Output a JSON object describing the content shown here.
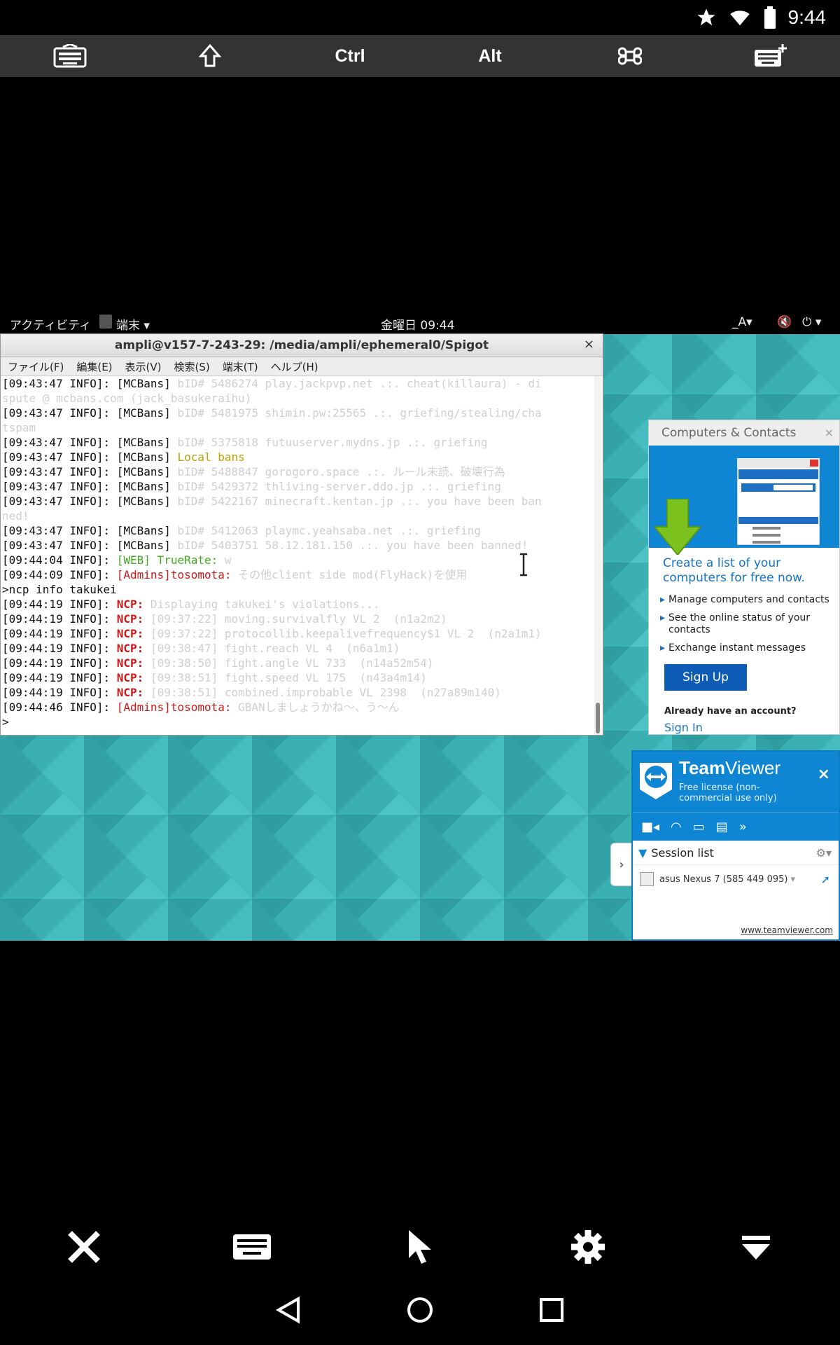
{
  "status_bar": {
    "time": "9:44",
    "icons": [
      "star-icon",
      "wifi-icon",
      "battery-icon"
    ]
  },
  "key_toolbar": {
    "keys": [
      {
        "icon": "keyboard-hide-icon",
        "label": ""
      },
      {
        "icon": "shift-icon",
        "label": ""
      },
      {
        "icon": "",
        "label": "Ctrl"
      },
      {
        "icon": "",
        "label": "Alt"
      },
      {
        "icon": "command-icon",
        "label": ""
      },
      {
        "icon": "keyboard-add-icon",
        "label": ""
      }
    ]
  },
  "gnome_bar": {
    "activities": "アクティビティ",
    "app_menu": "端末",
    "clock": "金曜日 09:44",
    "input_method": "_A",
    "right_icons": [
      "volume-muted-icon",
      "power-icon"
    ]
  },
  "terminal": {
    "title": "ampli@v157-7-243-29: /media/ampli/ephemeral0/Spigot",
    "close": "×",
    "menu": [
      "ファイル(F)",
      "編集(E)",
      "表示(V)",
      "検索(S)",
      "端末(T)",
      "ヘルプ(H)"
    ],
    "lines": [
      {
        "prefix": "[09:43:47 INFO]: [MCBans] ",
        "tag": "",
        "tag_color": "",
        "rest": "bID# 5486274 play.jackpvp.net .:. cheat(killaura) - di"
      },
      {
        "prefix": "",
        "tag": "",
        "tag_color": "",
        "rest": "spute @ mcbans.com (jack_basukeraihu)"
      },
      {
        "prefix": "[09:43:47 INFO]: [MCBans] ",
        "tag": "",
        "tag_color": "",
        "rest": "bID# 5481975 shimin.pw:25565 .:. griefing/stealing/cha"
      },
      {
        "prefix": "",
        "tag": "",
        "tag_color": "",
        "rest": "tspam"
      },
      {
        "prefix": "[09:43:47 INFO]: [MCBans] ",
        "tag": "",
        "tag_color": "",
        "rest": "bID# 5375818 futuuserver.mydns.jp .:. griefing"
      },
      {
        "prefix": "[09:43:47 INFO]: [MCBans] ",
        "tag": "Local bans",
        "tag_color": "yellow",
        "rest": ""
      },
      {
        "prefix": "[09:43:47 INFO]: [MCBans] ",
        "tag": "",
        "tag_color": "",
        "rest": "bID# 5488847 gorogoro.space .:. ルール未読、破壊行為"
      },
      {
        "prefix": "[09:43:47 INFO]: [MCBans] ",
        "tag": "",
        "tag_color": "",
        "rest": "bID# 5429372 thliving-server.ddo.jp .:. griefing"
      },
      {
        "prefix": "[09:43:47 INFO]: [MCBans] ",
        "tag": "",
        "tag_color": "",
        "rest": "bID# 5422167 minecraft.kentan.jp .:. you have been ban"
      },
      {
        "prefix": "",
        "tag": "",
        "tag_color": "",
        "rest": "ned!"
      },
      {
        "prefix": "[09:43:47 INFO]: [MCBans] ",
        "tag": "",
        "tag_color": "",
        "rest": "bID# 5412063 playmc.yeahsaba.net .:. griefing"
      },
      {
        "prefix": "[09:43:47 INFO]: [MCBans] ",
        "tag": "",
        "tag_color": "",
        "rest": "bID# 5403751 58.12.181.150 .:. you have been banned!"
      },
      {
        "prefix": "[09:44:04 INFO]: ",
        "tag": "[WEB] TrueRate:",
        "tag_color": "green",
        "rest": " w"
      },
      {
        "prefix": "[09:44:09 INFO]: ",
        "tag": "[Admins]tosomota:",
        "tag_color": "red",
        "rest": " その他client side mod(FlyHack)を使用"
      },
      {
        "prefix": ">ncp info takukei",
        "tag": "",
        "tag_color": "",
        "rest": ""
      },
      {
        "prefix": "[09:44:19 INFO]: ",
        "tag": "NCP:",
        "tag_color": "ncp",
        "rest": " Displaying takukei's violations..."
      },
      {
        "prefix": "[09:44:19 INFO]: ",
        "tag": "NCP:",
        "tag_color": "ncp",
        "rest": " [09:37:22] moving.survivalfly VL 2  (n1a2m2)"
      },
      {
        "prefix": "[09:44:19 INFO]: ",
        "tag": "NCP:",
        "tag_color": "ncp",
        "rest": " [09:37:22] protocollib.keepalivefrequency$1 VL 2  (n2a1m1)"
      },
      {
        "prefix": "[09:44:19 INFO]: ",
        "tag": "NCP:",
        "tag_color": "ncp",
        "rest": " [09:38:47] fight.reach VL 4  (n6a1m1)"
      },
      {
        "prefix": "[09:44:19 INFO]: ",
        "tag": "NCP:",
        "tag_color": "ncp",
        "rest": " [09:38:50] fight.angle VL 733  (n14a52m54)"
      },
      {
        "prefix": "[09:44:19 INFO]: ",
        "tag": "NCP:",
        "tag_color": "ncp",
        "rest": " [09:38:51] fight.speed VL 175  (n43a4m14)"
      },
      {
        "prefix": "[09:44:19 INFO]: ",
        "tag": "NCP:",
        "tag_color": "ncp",
        "rest": " [09:38:51] combined.improbable VL 2398  (n27a89m140)"
      },
      {
        "prefix": "[09:44:46 INFO]: ",
        "tag": "[Admins]tosomota:",
        "tag_color": "red",
        "rest": " GBANしましょうかね〜、う〜ん"
      },
      {
        "prefix": ">",
        "tag": "",
        "tag_color": "",
        "rest": ""
      }
    ]
  },
  "computers_contacts": {
    "title": "Computers & Contacts",
    "close": "×",
    "heading": "Create a list of your computers for free now.",
    "bullets": [
      "Manage computers and contacts",
      "See the online status of your contacts",
      "Exchange instant messages"
    ],
    "signup": "Sign Up",
    "already": "Already have an account?",
    "signin": "Sign In"
  },
  "teamviewer": {
    "name_bold": "Team",
    "name_rest": "Viewer",
    "subtitle": "Free license (non-commercial use only)",
    "close": "×",
    "tools": [
      "video-icon",
      "headset-icon",
      "chat-icon",
      "files-icon",
      "more-icon"
    ],
    "session_list": "Session list",
    "session": "asus Nexus 7 (585 449 095)",
    "link": "www.teamviewer.com"
  },
  "app_toolbar": {
    "buttons": [
      "close-icon",
      "keyboard-icon",
      "pointer-icon",
      "settings-icon",
      "collapse-icon"
    ]
  },
  "nav_bar": {
    "buttons": [
      "back-icon",
      "home-icon",
      "recents-icon"
    ]
  }
}
